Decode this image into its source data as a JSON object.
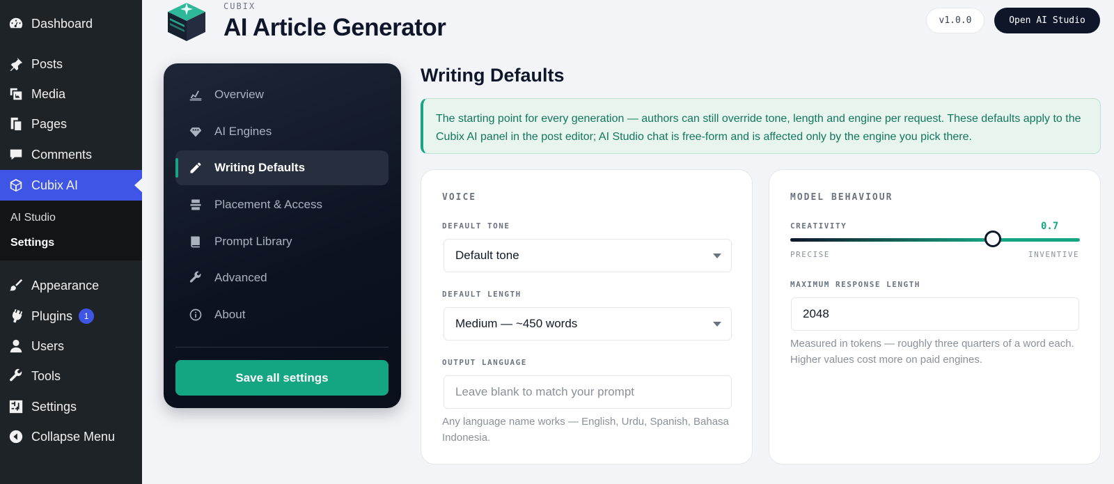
{
  "wp_menu": {
    "items": [
      {
        "label": "Dashboard",
        "icon": "dashboard-icon"
      },
      {
        "label": "Posts",
        "icon": "pin-icon"
      },
      {
        "label": "Media",
        "icon": "media-icon"
      },
      {
        "label": "Pages",
        "icon": "pages-icon"
      },
      {
        "label": "Comments",
        "icon": "comment-icon"
      },
      {
        "label": "Cubix AI",
        "icon": "cube-icon"
      },
      {
        "label": "Appearance",
        "icon": "brush-icon"
      },
      {
        "label": "Plugins",
        "icon": "plug-icon"
      },
      {
        "label": "Users",
        "icon": "user-icon"
      },
      {
        "label": "Tools",
        "icon": "wrench-icon"
      },
      {
        "label": "Settings",
        "icon": "sliders-icon"
      },
      {
        "label": "Collapse Menu",
        "icon": "collapse-icon"
      }
    ],
    "submenu": [
      "AI Studio",
      "Settings"
    ],
    "plugins_badge": "1"
  },
  "header": {
    "brand": "CUBIX",
    "title": "AI Article Generator",
    "version": "v1.0.0",
    "studio_button": "Open AI Studio"
  },
  "settings_nav": {
    "items": [
      {
        "label": "Overview",
        "icon": "chart-icon"
      },
      {
        "label": "AI Engines",
        "icon": "diamond-icon"
      },
      {
        "label": "Writing Defaults",
        "icon": "pencil-icon"
      },
      {
        "label": "Placement & Access",
        "icon": "layers-icon"
      },
      {
        "label": "Prompt Library",
        "icon": "book-icon"
      },
      {
        "label": "Advanced",
        "icon": "wrench-icon"
      },
      {
        "label": "About",
        "icon": "info-icon"
      }
    ],
    "active": "Writing Defaults",
    "save_label": "Save all settings"
  },
  "main": {
    "title": "Writing Defaults",
    "notice": "The starting point for every generation — authors can still override tone, length and engine per request. These defaults apply to the Cubix AI panel in the post editor; AI Studio chat is free-form and is affected only by the engine you pick there.",
    "voice": {
      "heading": "VOICE",
      "tone_label": "DEFAULT TONE",
      "tone_value": "Default tone",
      "length_label": "DEFAULT LENGTH",
      "length_value": "Medium — ~450 words",
      "language_label": "OUTPUT LANGUAGE",
      "language_value": "",
      "language_placeholder": "Leave blank to match your prompt",
      "language_help": "Any language name works — English, Urdu, Spanish, Bahasa Indonesia."
    },
    "model": {
      "heading": "MODEL BEHAVIOUR",
      "creativity_label": "CREATIVITY",
      "creativity_value": "0.7",
      "creativity_fraction": 0.7,
      "low_label": "PRECISE",
      "high_label": "INVENTIVE",
      "max_length_label": "MAXIMUM RESPONSE LENGTH",
      "max_length_value": "2048",
      "max_length_help": "Measured in tokens — roughly three quarters of a word each. Higher values cost more on paid engines."
    }
  },
  "colors": {
    "accent": "#17a683",
    "wp_active": "#3f55e6",
    "track_dark": "#0f1629"
  }
}
